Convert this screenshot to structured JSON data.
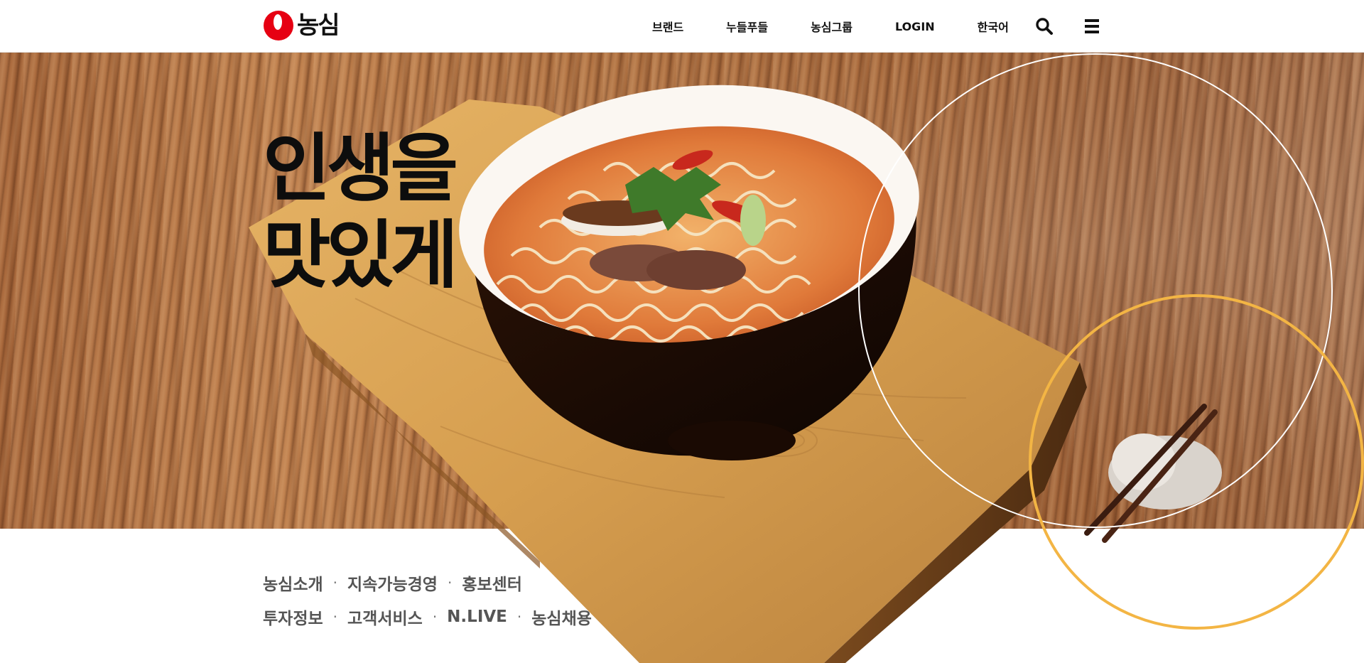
{
  "brand": {
    "name": "농심"
  },
  "nav": {
    "items": [
      "브랜드",
      "누들푸들",
      "농심그룹",
      "LOGIN",
      "한국어"
    ]
  },
  "icons": {
    "search": "search-icon",
    "menu": "hamburger-menu-icon"
  },
  "hero": {
    "line1": "인생을",
    "line2": "맛있게"
  },
  "footer_links": {
    "row1": [
      "농심소개",
      "지속가능경영",
      "홍보센터"
    ],
    "row2": [
      "투자정보",
      "고객서비스",
      "N.LIVE",
      "농심채용"
    ],
    "separator": "·"
  },
  "colors": {
    "brand_red": "#e60012",
    "accent_yellow": "#f3b544"
  }
}
